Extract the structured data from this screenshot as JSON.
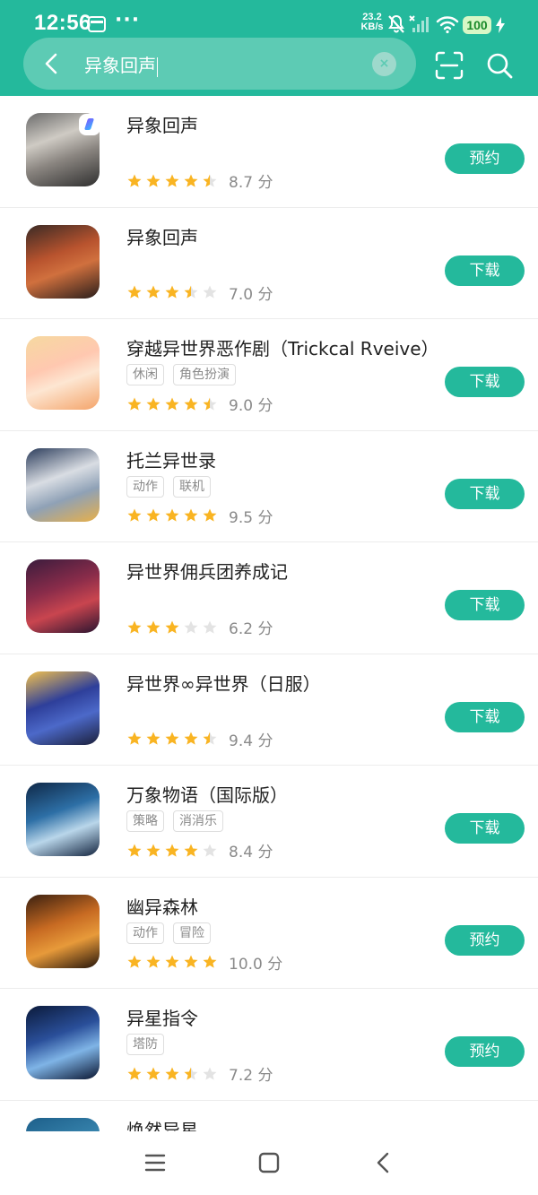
{
  "status_bar": {
    "time": "12:56",
    "more": "···",
    "net_speed_value": "23.2",
    "net_speed_unit": "KB/s",
    "battery": "100"
  },
  "search": {
    "query": "异象回声",
    "clear_label": "×"
  },
  "colors": {
    "brand": "#24b99c",
    "star_on": "#f9b422",
    "star_off": "#e3e3e3"
  },
  "apps": [
    {
      "title": "异象回声",
      "tags": [],
      "stars": 4.5,
      "score": "8.7 分",
      "action": "预约",
      "badge": true
    },
    {
      "title": "异象回声",
      "tags": [],
      "stars": 3.5,
      "score": "7.0 分",
      "action": "下载",
      "badge": false
    },
    {
      "title": "穿越异世界恶作剧（Trickcal Rveive）",
      "tags": [
        "休闲",
        "角色扮演"
      ],
      "stars": 4.5,
      "score": "9.0 分",
      "action": "下载",
      "badge": false
    },
    {
      "title": "托兰异世录",
      "tags": [
        "动作",
        "联机"
      ],
      "stars": 5,
      "score": "9.5 分",
      "action": "下载",
      "badge": false
    },
    {
      "title": "异世界佣兵团养成记",
      "tags": [],
      "stars": 3,
      "score": "6.2 分",
      "action": "下载",
      "badge": false
    },
    {
      "title": "异世界∞异世界（日服）",
      "tags": [],
      "stars": 4.5,
      "score": "9.4 分",
      "action": "下载",
      "badge": false
    },
    {
      "title": "万象物语（国际版）",
      "tags": [
        "策略",
        "消消乐"
      ],
      "stars": 4,
      "score": "8.4 分",
      "action": "下载",
      "badge": false
    },
    {
      "title": "幽异森林",
      "tags": [
        "动作",
        "冒险"
      ],
      "stars": 5,
      "score": "10.0 分",
      "action": "预约",
      "badge": false
    },
    {
      "title": "异星指令",
      "tags": [
        "塔防"
      ],
      "stars": 3.5,
      "score": "7.2 分",
      "action": "预约",
      "badge": false
    },
    {
      "title": "焕然异星",
      "tags": [],
      "stars": null,
      "score": "",
      "action": "",
      "badge": false
    }
  ],
  "nav": {
    "menu": "menu-icon",
    "home": "home-icon",
    "back": "back-icon"
  }
}
